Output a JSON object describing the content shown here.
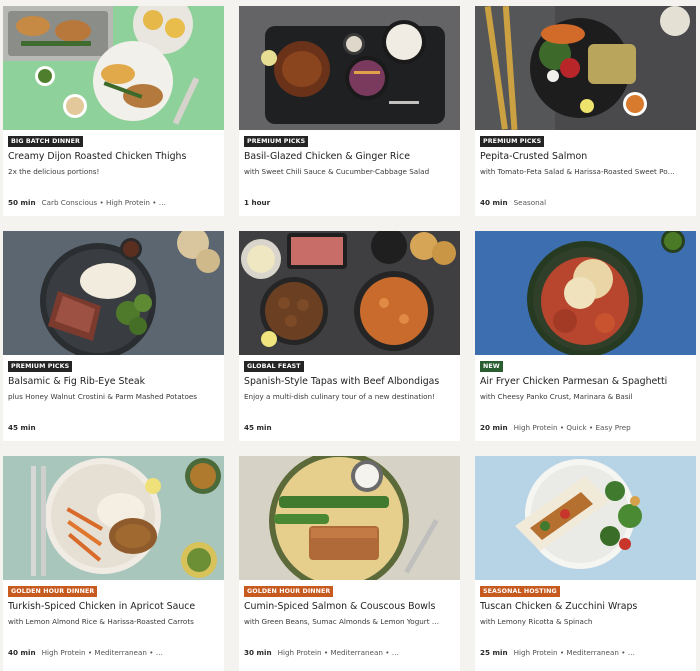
{
  "recipes": [
    {
      "badge": "BIG BATCH DINNER",
      "badge_color": "#242424",
      "title": "Creamy Dijon Roasted Chicken Thighs",
      "subtitle": "2x the delicious portions!",
      "time": "50 min",
      "tags": "Carb Conscious • High Protein • …",
      "bg": "#8fd19a"
    },
    {
      "badge": "PREMIUM PICKS",
      "badge_color": "#242424",
      "title": "Basil-Glazed Chicken & Ginger Rice",
      "subtitle": "with Sweet Chili Sauce & Cucumber-Cabbage Salad",
      "time": "1 hour",
      "tags": "",
      "bg": "#5b5b5d"
    },
    {
      "badge": "PREMIUM PICKS",
      "badge_color": "#242424",
      "title": "Pepita-Crusted Salmon",
      "subtitle": "with Tomato-Feta Salad & Harissa-Roasted Sweet Po…",
      "time": "40 min",
      "tags": "Seasonal",
      "bg": "#4a4a4d"
    },
    {
      "badge": "PREMIUM PICKS",
      "badge_color": "#242424",
      "title": "Balsamic & Fig Rib-Eye Steak",
      "subtitle": "plus Honey Walnut Crostini & Parm Mashed Potatoes",
      "time": "45 min",
      "tags": "",
      "bg": "#5c6670"
    },
    {
      "badge": "GLOBAL FEAST",
      "badge_color": "#242424",
      "title": "Spanish-Style Tapas with Beef Albondigas",
      "subtitle": "Enjoy a multi-dish culinary tour of a new destination!",
      "time": "45 min",
      "tags": "",
      "bg": "#3f3f42"
    },
    {
      "badge": "NEW",
      "badge_color": "#2a5d2f",
      "title": "Air Fryer Chicken Parmesan & Spaghetti",
      "subtitle": "with Cheesy Panko Crust, Marinara & Basil",
      "time": "20 min",
      "tags": "High Protein • Quick • Easy Prep",
      "bg": "#3d6fb0"
    },
    {
      "badge": "GOLDEN HOUR DINNER",
      "badge_color": "#c75a1f",
      "title": "Turkish-Spiced Chicken in Apricot Sauce",
      "subtitle": "with Lemon Almond Rice & Harissa-Roasted Carrots",
      "time": "40 min",
      "tags": "High Protein • Mediterranean • …",
      "bg": "#a9c6bd"
    },
    {
      "badge": "GOLDEN HOUR DINNER",
      "badge_color": "#c75a1f",
      "title": "Cumin-Spiced Salmon & Couscous Bowls",
      "subtitle": "with Green Beans, Sumac Almonds & Lemon Yogurt …",
      "time": "30 min",
      "tags": "High Protein • Mediterranean • …",
      "bg": "#d7d2c6"
    },
    {
      "badge": "SEASONAL HOSTING",
      "badge_color": "#c75a1f",
      "title": "Tuscan Chicken & Zucchini Wraps",
      "subtitle": "with Lemony Ricotta & Spinach",
      "time": "25 min",
      "tags": "High Protein • Mediterranean • …",
      "bg": "#b7d3e6"
    }
  ]
}
